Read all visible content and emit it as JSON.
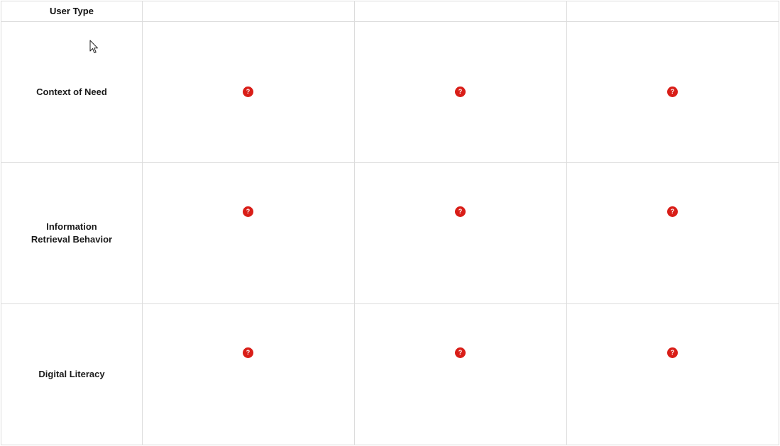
{
  "table": {
    "header": {
      "label": "User Type",
      "columns": [
        "",
        "",
        ""
      ]
    },
    "rows": [
      {
        "label": "Context of Need",
        "cells": [
          "?",
          "?",
          "?"
        ]
      },
      {
        "label": "Information\nRetrieval Behavior",
        "cells": [
          "?",
          "?",
          "?"
        ]
      },
      {
        "label": "Digital Literacy",
        "cells": [
          "?",
          "?",
          "?"
        ]
      }
    ]
  },
  "icons": {
    "cell_icon": "question-mark-circle-icon",
    "pointer": "mouse-pointer-icon"
  },
  "colors": {
    "badge": "#d91e18",
    "grid_line": "#dcdcdc"
  }
}
